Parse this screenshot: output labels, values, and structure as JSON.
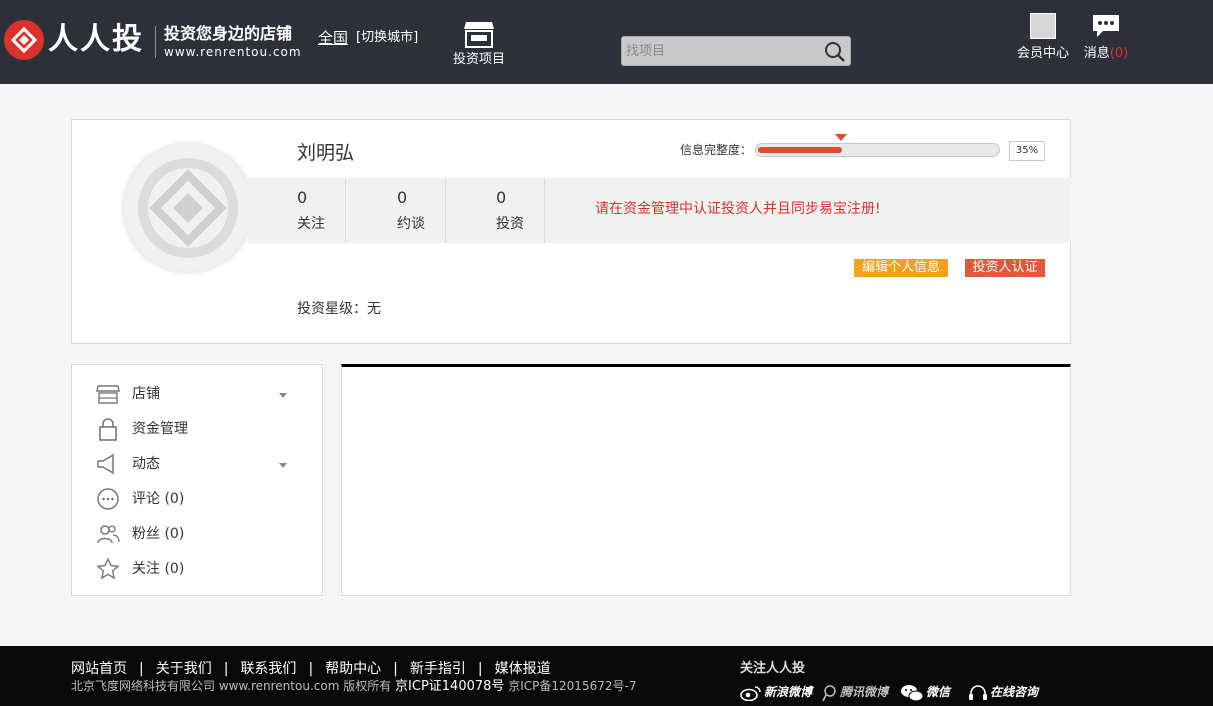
{
  "header": {
    "brand": "人人投",
    "slogan": "投资您身边的店铺",
    "site_url": "www.renrentou.com",
    "city": "全国",
    "switch_city": "[切换城市]",
    "invest_nav": "投资项目",
    "search_placeholder": "找项目",
    "member_center": "会员中心",
    "messages_label": "消息",
    "messages_count": "(0)"
  },
  "profile": {
    "name": "刘明弘",
    "completeness_label": "信息完整度：",
    "completeness_pct": "35%",
    "completeness_value": 0.35,
    "stats": [
      {
        "value": "0",
        "label": "关注"
      },
      {
        "value": "0",
        "label": "约谈"
      },
      {
        "value": "0",
        "label": "投资"
      }
    ],
    "notice": "请在资金管理中认证投资人并且同步易宝注册!",
    "edit_button": "编辑个人信息",
    "verify_button": "投资人认证",
    "star_level": "投资星级：无"
  },
  "sidebar": {
    "items": [
      {
        "label": "店铺",
        "icon": "shop-icon",
        "has_caret": true
      },
      {
        "label": "资金管理",
        "icon": "lock-icon",
        "has_caret": false
      },
      {
        "label": "动态",
        "icon": "megaphone-icon",
        "has_caret": true
      },
      {
        "label": "评论 (0)",
        "icon": "comment-icon",
        "has_caret": false
      },
      {
        "label": "粉丝 (0)",
        "icon": "fans-icon",
        "has_caret": false
      },
      {
        "label": "关注 (0)",
        "icon": "star-icon",
        "has_caret": false
      }
    ]
  },
  "footer": {
    "links": [
      "网站首页",
      "关于我们",
      "联系我们",
      "帮助中心",
      "新手指引",
      "媒体报道"
    ],
    "copyright_prefix": "北京飞度网络科技有限公司 www.renrentou.com 版权所有",
    "license": "京ICP证140078号",
    "icp": "京ICP备12015672号-7",
    "follow_title": "关注人人投",
    "social": {
      "weibo": "新浪微博",
      "tweibo": "腾讯微博",
      "wechat": "微信",
      "consult": "在线咨询"
    }
  },
  "colors": {
    "header_bg": "#2d3039",
    "accent_red": "#d9342b",
    "button_orange": "#f4a020",
    "button_red": "#e05a3a"
  }
}
